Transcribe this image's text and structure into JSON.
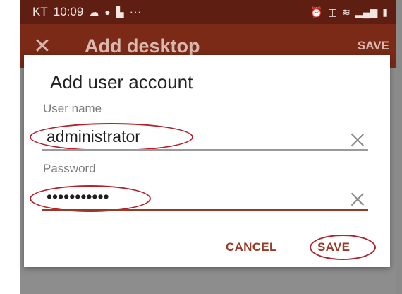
{
  "status_bar": {
    "carrier": "KT",
    "time": "10:09",
    "ellipsis": "···",
    "icons_left": [
      "cloud-icon",
      "chat-bubble-icon",
      "notification-icon"
    ],
    "icons_right": [
      "alarm-icon",
      "hd-icon",
      "wifi-icon",
      "signal-icon",
      "battery-icon"
    ]
  },
  "app_bar": {
    "title": "Add desktop",
    "save_label": "SAVE"
  },
  "dialog": {
    "title": "Add user account",
    "username": {
      "label": "User name",
      "value": "administrator"
    },
    "password": {
      "label": "Password",
      "value": "•••••••••••"
    },
    "cancel_label": "CANCEL",
    "save_label": "SAVE"
  },
  "colors": {
    "status_bar": "#5e1e12",
    "app_bar": "#7a2a17",
    "accent": "#9a3a26",
    "highlight_ring": "#b5202a"
  }
}
